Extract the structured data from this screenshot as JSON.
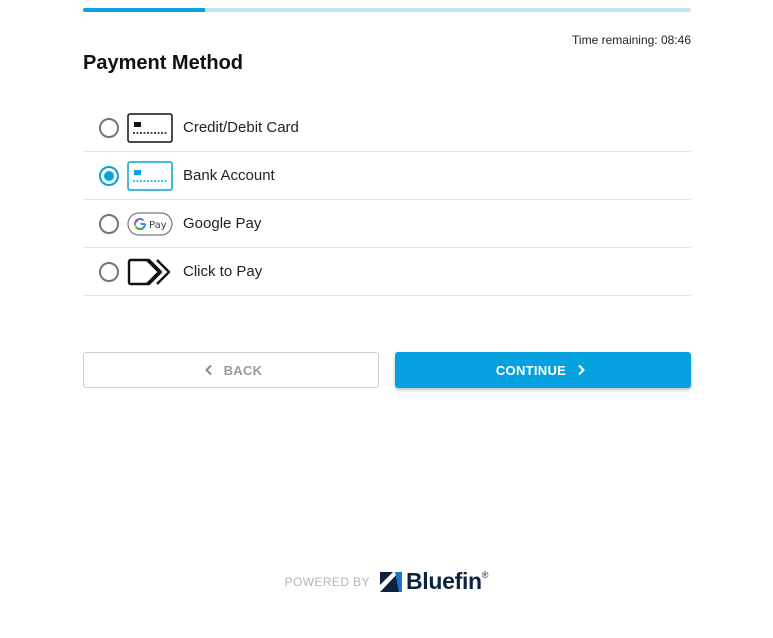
{
  "progress": {
    "value": 0.2,
    "color": "#0aa2dc",
    "track_color": "#c4e4ee"
  },
  "timer": {
    "text": "Time remaining: 08:46"
  },
  "page": {
    "title": "Payment Method"
  },
  "methods": [
    {
      "label": "Credit/Debit Card",
      "icon": "credit-card-icon",
      "selected": false
    },
    {
      "label": "Bank Account",
      "icon": "bank-account-icon",
      "selected": true
    },
    {
      "label": "Google Pay",
      "icon": "google-pay-icon",
      "selected": false
    },
    {
      "label": "Click to Pay",
      "icon": "click-to-pay-icon",
      "selected": false
    }
  ],
  "buttons": {
    "back": "BACK",
    "continue": "CONTINUE"
  },
  "footer": {
    "powered_by": "POWERED BY",
    "brand": "Bluefin",
    "reg_mark": "®"
  },
  "colors": {
    "accent": "#06a2df",
    "brand_navy": "#0c2340"
  }
}
